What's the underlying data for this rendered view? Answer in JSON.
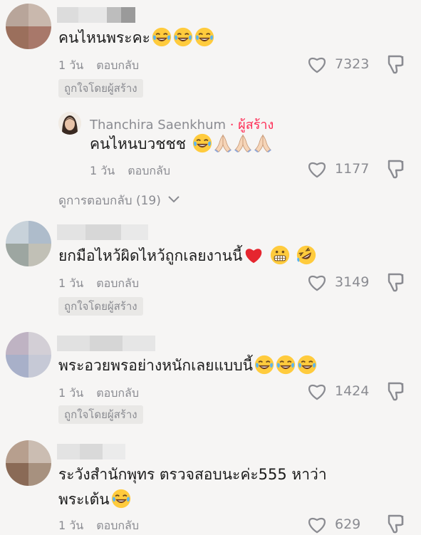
{
  "comments": [
    {
      "text": "คนไหนพระคะ",
      "time": "1 วัน",
      "reply_label": "ตอบกลับ",
      "likes": "7323",
      "badge": "ถูกใจโดยผู้สร้าง"
    },
    {
      "text": "ยกมือไหว้ผิดไหว้ถูกเลยงานนี้",
      "time": "1 วัน",
      "reply_label": "ตอบกลับ",
      "likes": "3149",
      "badge": "ถูกใจโดยผู้สร้าง"
    },
    {
      "text": "พระอวยพรอย่างหนักเลยแบบนี้",
      "time": "1 วัน",
      "reply_label": "ตอบกลับ",
      "likes": "1424",
      "badge": "ถูกใจโดยผู้สร้าง"
    },
    {
      "text_line1": "ระวังสำนักพุทร ตรวจสอบนะค่ะ555 หาว่า",
      "text_line2": "พระเต้น",
      "time": "1 วัน",
      "reply_label": "ตอบกลับ",
      "likes": "629"
    }
  ],
  "creator_reply": {
    "name": "Thanchira Saenkhum",
    "tag": " · ผู้สร้าง",
    "text": "คนไหนบวชชช",
    "time": "1 วัน",
    "reply_label": "ตอบกลับ",
    "likes": "1177"
  },
  "view_replies": "ดูการตอบกลับ (19)",
  "colors": {
    "background": "#f6f5f4",
    "creator_tag": "#fe2c55",
    "muted": "#8a8b91"
  },
  "icons": [
    "heart-outline-icon",
    "dislike-icon",
    "face-tears-of-joy-icon",
    "folded-hands-icon",
    "red-heart-icon",
    "grimacing-face-icon",
    "rolling-laughing-icon",
    "chevron-down-icon"
  ]
}
